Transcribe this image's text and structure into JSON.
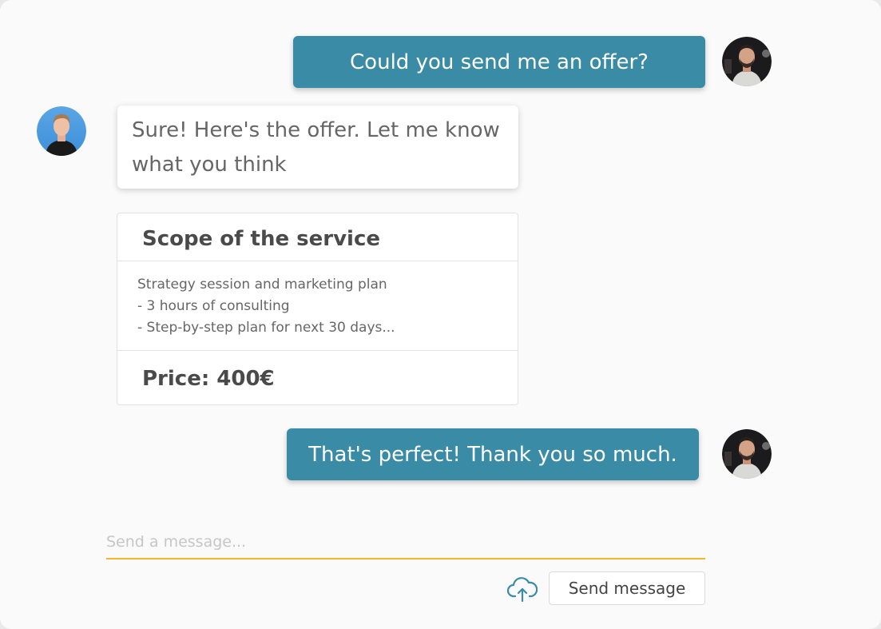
{
  "messages": [
    {
      "direction": "outgoing",
      "text": "Could you send me an offer?"
    },
    {
      "direction": "incoming",
      "text": "Sure! Here's the offer. Let me know what you think"
    },
    {
      "direction": "outgoing",
      "text": "That's perfect! Thank you so much."
    }
  ],
  "offer": {
    "title": "Scope of the service",
    "lines": [
      "Strategy session and marketing plan",
      "- 3 hours of consulting",
      "- Step-by-step plan for next 30 days..."
    ],
    "price": "Price: 400€"
  },
  "composer": {
    "placeholder": "Send a message...",
    "send_label": "Send message",
    "upload_icon": "cloud-upload-icon"
  },
  "colors": {
    "outgoing_bubble": "#3a8ba6",
    "input_underline": "#f3b82a",
    "background": "#fafafa"
  }
}
